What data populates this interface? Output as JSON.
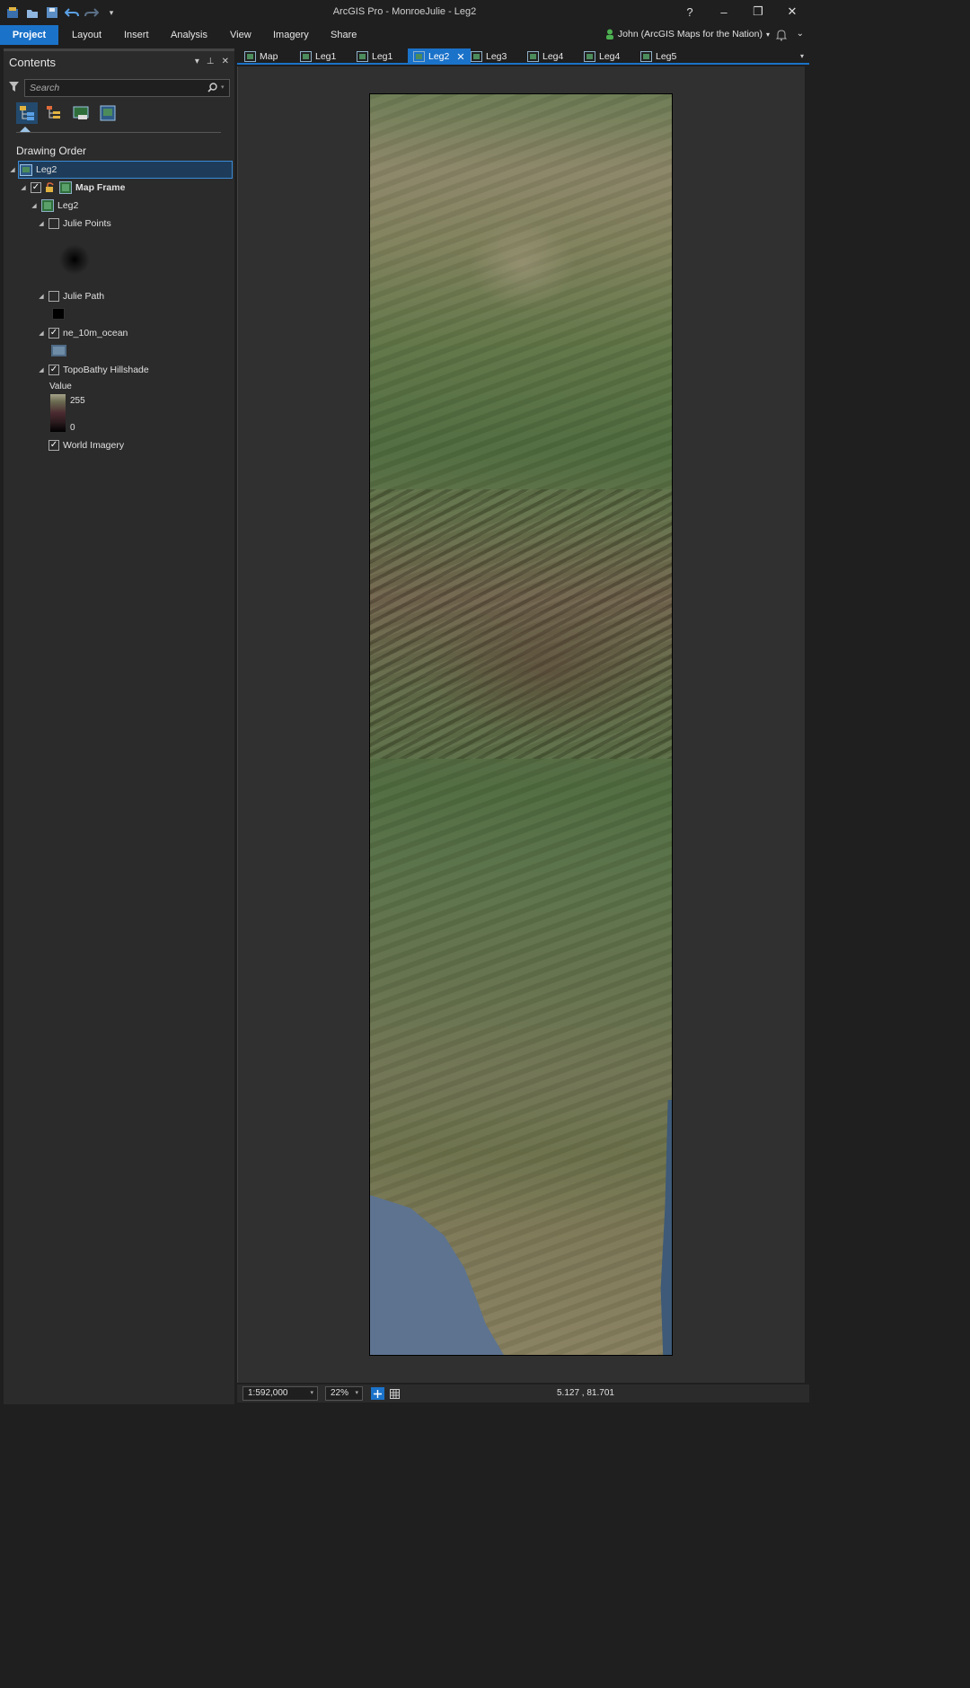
{
  "window": {
    "title": "ArcGIS Pro - MonroeJulie - Leg2",
    "help": "?",
    "minimize": "–",
    "restore": "❐",
    "close": "✕"
  },
  "ribbon": {
    "tabs": [
      "Project",
      "Layout",
      "Insert",
      "Analysis",
      "View",
      "Imagery",
      "Share"
    ],
    "user_label": "John (ArcGIS Maps for the Nation)"
  },
  "contents": {
    "title": "Contents",
    "search_placeholder": "Search",
    "section": "Drawing Order",
    "root": "Leg2",
    "map_frame": "Map Frame",
    "map": "Leg2",
    "layers": {
      "julie_points": "Julie Points",
      "julie_path": "Julie Path",
      "ocean": "ne_10m_ocean",
      "hillshade": "TopoBathy Hillshade",
      "value_label": "Value",
      "value_high": "255",
      "value_low": "0",
      "imagery": "World Imagery"
    },
    "check_mark": "✓"
  },
  "map_tabs": [
    "Map",
    "Leg1",
    "Leg1",
    "Leg2",
    "Leg3",
    "Leg4",
    "Leg4",
    "Leg5"
  ],
  "active_tab_close": "✕",
  "status": {
    "scale": "1:592,000",
    "zoom": "22%",
    "coords": "5.127 , 81.701"
  },
  "colors": {
    "accent": "#1b72c9",
    "background": "#1f1f1f",
    "pane": "#2b2b2b"
  }
}
